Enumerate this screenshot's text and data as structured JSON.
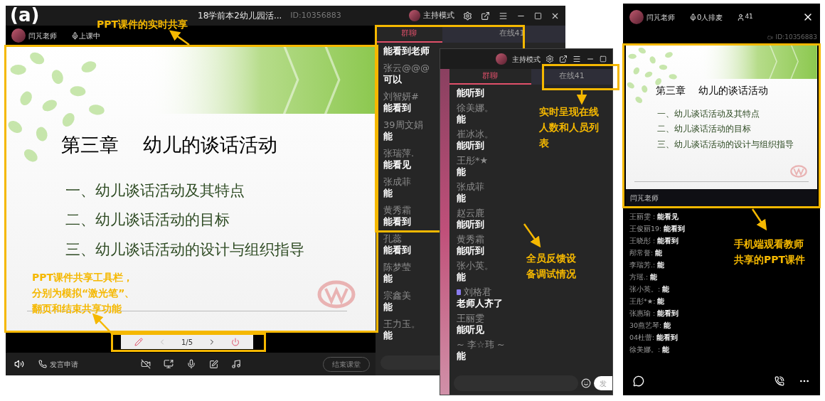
{
  "figure_label": "(a)",
  "desktop": {
    "title": "18学前本2幼儿园活...",
    "room_id": "ID:10356883",
    "mode": "主持模式",
    "teacher": "闫芃老师",
    "status": "上课中",
    "slide": {
      "chapter": "第三章",
      "title": "幼儿的谈话活动",
      "items": [
        "一、幼儿谈话活动及其特点",
        "二、幼儿谈话活动的目标",
        "三、幼儿谈话活动的设计与组织指导"
      ]
    },
    "pager": {
      "page": "1/5"
    },
    "speak_request": "发言申请",
    "end_class": "结束课堂",
    "chat": {
      "tabs": [
        {
          "label": "群聊",
          "selected": true
        },
        {
          "label": "在线41",
          "selected": false
        }
      ],
      "messages": [
        {
          "text": "能看到老师"
        },
        {
          "name": "张云@@@",
          "text": "可以"
        },
        {
          "name": "刘智妍#",
          "text": "能看到"
        },
        {
          "name": "39周文娟",
          "text": "能"
        },
        {
          "name": "张瑞萍.",
          "text": "能看见"
        },
        {
          "name": "张成菲",
          "text": "能"
        },
        {
          "name": "黄秀霜",
          "text": "能看到"
        },
        {
          "name": "孔蕊",
          "text": "能看到"
        },
        {
          "name": "陈梦莹",
          "text": "能"
        },
        {
          "name": "宗鑫美",
          "text": "能"
        },
        {
          "name": "王力玉。",
          "text": "能"
        }
      ]
    }
  },
  "chat_window": {
    "mode": "主持模式",
    "tabs": [
      {
        "label": "群聊",
        "selected": true
      },
      {
        "label": "在线41",
        "selected": false
      }
    ],
    "messages": [
      {
        "text": "能听到",
        "badge": false
      },
      {
        "name": "徐美娜。",
        "text": "能",
        "badge": false
      },
      {
        "name": "崔冰冰。",
        "text": "能听到",
        "badge": false
      },
      {
        "name": "王彤*★",
        "text": "能",
        "badge": false
      },
      {
        "name": "张成菲",
        "text": "能",
        "badge": false
      },
      {
        "name": "赵云鹿",
        "text": "能听到",
        "badge": false
      },
      {
        "name": "黄秀霜",
        "text": "能听到",
        "badge": false
      },
      {
        "name": "张小英。",
        "text": "能",
        "badge": false
      },
      {
        "name": "刘格君",
        "text": "老师人齐了",
        "badge": true
      },
      {
        "name": "王丽雯",
        "text": "能听见",
        "badge": false
      },
      {
        "name": "~ 李☆玮 ~",
        "text": "能",
        "badge": false
      }
    ],
    "send": "发"
  },
  "phone": {
    "teacher": "闫芃老师",
    "queue": "0人排麦",
    "online": "41",
    "room_id": "ID:10356883",
    "slide": {
      "chapter": "第三章",
      "title": "幼儿的谈话活动",
      "items": [
        "一、幼儿谈话活动及其特点",
        "二、幼儿谈话活动的目标",
        "三、幼儿谈话活动的设计与组织指导"
      ]
    },
    "presenter": "闫芃老师",
    "chat": [
      {
        "name": "王丽雯 :",
        "text": "能看见"
      },
      {
        "name": "王俊丽19:",
        "text": "能看到"
      },
      {
        "name": "王晓彤 :",
        "text": "能看到"
      },
      {
        "name": "邴常誉:",
        "text": "能"
      },
      {
        "name": "李瑞芳.:",
        "text": "能"
      },
      {
        "name": "方瑶.:",
        "text": "能"
      },
      {
        "name": "张小英。:",
        "text": "能"
      },
      {
        "name": "王彤*★:",
        "text": "能"
      },
      {
        "name": "张惠瑜 :",
        "text": "能看到"
      },
      {
        "name": "30燕艺琴:",
        "text": "能"
      },
      {
        "name": "04杜蕾:",
        "text": "能看到"
      },
      {
        "name": "徐美娜。:",
        "text": "能"
      }
    ]
  },
  "annotations": [
    {
      "lines": [
        "PPT课件的实时共享"
      ]
    },
    {
      "lines": [
        "PPT课件共享工具栏，",
        "分别为模拟“激光笔”、",
        "翻页和结束共享功能"
      ]
    },
    {
      "lines": [
        "实时呈现在线",
        "人数和人员列",
        "表"
      ]
    },
    {
      "lines": [
        "全员反馈设",
        "备调试情况"
      ]
    },
    {
      "lines": [
        "手机端观看教师",
        "共享的PPT课件"
      ]
    }
  ]
}
